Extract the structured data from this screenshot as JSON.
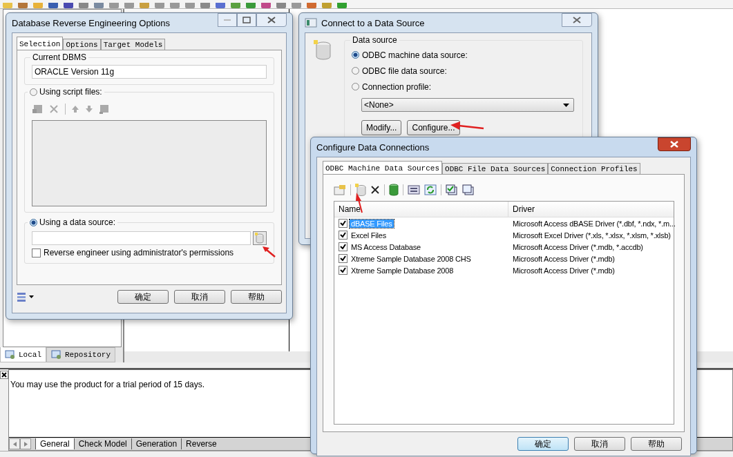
{
  "explorer_tabs": [
    {
      "label": "Local",
      "selected": true
    },
    {
      "label": "Repository",
      "selected": false
    }
  ],
  "output": {
    "message": "You may use the product for a trial period of 15 days.",
    "tabs": [
      {
        "label": "General",
        "selected": true
      },
      {
        "label": "Check Model",
        "selected": false
      },
      {
        "label": "Generation",
        "selected": false
      },
      {
        "label": "Reverse",
        "selected": false
      }
    ]
  },
  "reverse_dialog": {
    "title": "Database Reverse Engineering Options",
    "tabs": [
      {
        "label": "Selection",
        "selected": true
      },
      {
        "label": "Options",
        "selected": false
      },
      {
        "label": "Target Models",
        "selected": false
      }
    ],
    "current_dbms_label": "Current DBMS",
    "current_dbms": "ORACLE Version 11g",
    "script_option": {
      "label": "Using script files:",
      "selected": false
    },
    "data_source_option": {
      "label": "Using a data source:",
      "selected": true
    },
    "admin_permissions": {
      "label": "Reverse engineer using administrator's permissions",
      "checked": false
    },
    "buttons": [
      "确定",
      "取消",
      "帮助"
    ]
  },
  "connect_dialog": {
    "title": "Connect to a Data Source",
    "group_label": "Data source",
    "options": [
      {
        "label": "ODBC machine data source:",
        "selected": true
      },
      {
        "label": "ODBC file data source:",
        "selected": false
      },
      {
        "label": "Connection profile:",
        "selected": false
      }
    ],
    "profile": "<None>",
    "buttons": [
      "Modify...",
      "Configure..."
    ]
  },
  "configure_dialog": {
    "title": "Configure Data Connections",
    "tabs": [
      {
        "label": "ODBC Machine Data Sources",
        "selected": true
      },
      {
        "label": "ODBC File Data Sources",
        "selected": false
      },
      {
        "label": "Connection Profiles",
        "selected": false
      }
    ],
    "columns": [
      "Name",
      "Driver"
    ],
    "rows": [
      {
        "name": "dBASE Files",
        "driver": "Microsoft Access dBASE Driver (*.dbf, *.ndx, *.m...",
        "checked": true,
        "selected": true
      },
      {
        "name": "Excel Files",
        "driver": "Microsoft Excel Driver (*.xls, *.xlsx, *.xlsm, *.xlsb)",
        "checked": true,
        "selected": false
      },
      {
        "name": "MS Access Database",
        "driver": "Microsoft Access Driver (*.mdb, *.accdb)",
        "checked": true,
        "selected": false
      },
      {
        "name": "Xtreme Sample Database 2008 CHS",
        "driver": "Microsoft Access Driver (*.mdb)",
        "checked": true,
        "selected": false
      },
      {
        "name": "Xtreme Sample Database 2008",
        "driver": "Microsoft Access Driver (*.mdb)",
        "checked": true,
        "selected": false
      }
    ],
    "buttons": [
      "确定",
      "取消",
      "帮助"
    ]
  }
}
